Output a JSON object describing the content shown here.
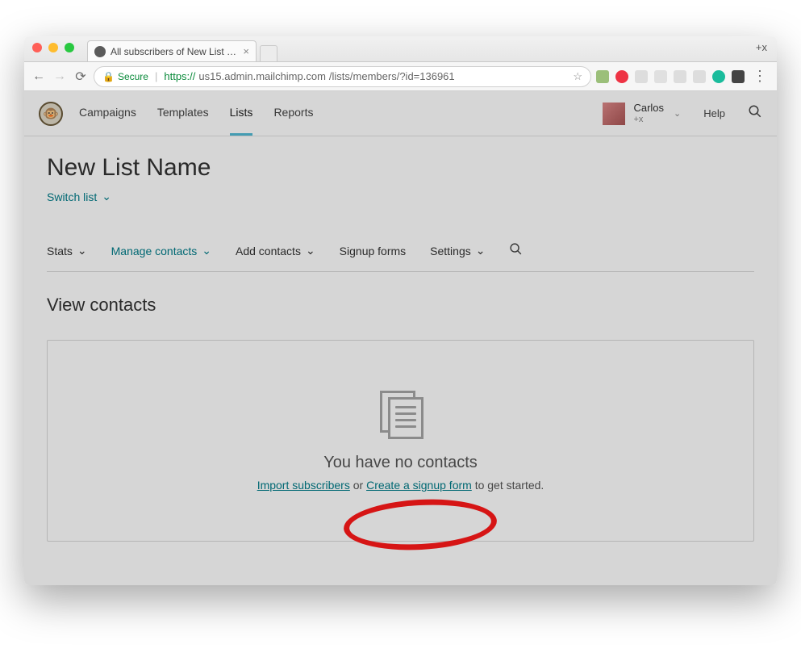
{
  "browser": {
    "tab_title": "All subscribers of New List Na",
    "plus_x": "+x",
    "secure_label": "Secure",
    "url_proto": "https://",
    "url_host": "us15.admin.mailchimp.com",
    "url_path": "/lists/members/?id=136961"
  },
  "topnav": {
    "items": [
      "Campaigns",
      "Templates",
      "Lists",
      "Reports"
    ],
    "active_index": 2,
    "user": {
      "name": "Carlos",
      "sub": "+x"
    },
    "help": "Help"
  },
  "list": {
    "title": "New List Name",
    "switch": "Switch list"
  },
  "subnav": {
    "items": [
      {
        "label": "Stats",
        "dropdown": true
      },
      {
        "label": "Manage contacts",
        "dropdown": true,
        "active": true
      },
      {
        "label": "Add contacts",
        "dropdown": true
      },
      {
        "label": "Signup forms",
        "dropdown": false
      },
      {
        "label": "Settings",
        "dropdown": true
      }
    ]
  },
  "section": {
    "title": "View contacts"
  },
  "empty": {
    "heading": "You have no contacts",
    "import_link": "Import subscribers",
    "or": " or ",
    "signup_link": "Create a signup form",
    "tail": " to get started."
  }
}
